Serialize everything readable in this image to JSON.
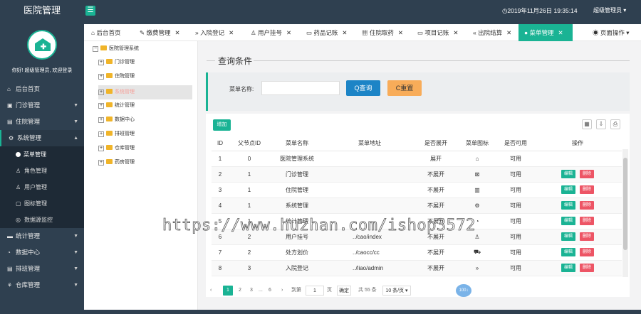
{
  "app": {
    "title": "医院管理",
    "menu_toggle_icon": "☰"
  },
  "header": {
    "datetime": "◷2019年11月26日 19:35:14",
    "user": "超级管理员"
  },
  "sidebar": {
    "welcome": "你好! 超级管理员, 欢迎登录",
    "items": [
      {
        "label": "后台首页",
        "icon": "⌂"
      },
      {
        "label": "门诊管理",
        "icon": "▣"
      },
      {
        "label": "住院管理",
        "icon": "▤"
      },
      {
        "label": "系统管理",
        "icon": "⚙"
      }
    ],
    "sub_items": [
      {
        "label": "菜单管理",
        "icon": "●"
      },
      {
        "label": "角色管理",
        "icon": "♙"
      },
      {
        "label": "用户管理",
        "icon": "♙"
      },
      {
        "label": "图标管理",
        "icon": "▢"
      },
      {
        "label": "数据源监控",
        "icon": "◎"
      }
    ],
    "items_after": [
      {
        "label": "统计管理",
        "icon": "▬"
      },
      {
        "label": "数据中心",
        "icon": "◔"
      },
      {
        "label": "排班管理",
        "icon": "▤"
      },
      {
        "label": "仓库管理",
        "icon": "⚘"
      }
    ]
  },
  "tabs": [
    {
      "label": "后台首页",
      "icon": "⌂"
    },
    {
      "label": "缴费管理",
      "icon": "✎"
    },
    {
      "label": "入院登记",
      "icon": "»"
    },
    {
      "label": "用户挂号",
      "icon": "♙"
    },
    {
      "label": "药品记账",
      "icon": "▭"
    },
    {
      "label": "住院取药",
      "icon": "▦"
    },
    {
      "label": "项目记账",
      "icon": "▭"
    },
    {
      "label": "出院结算",
      "icon": "«"
    },
    {
      "label": "菜单管理",
      "icon": "●"
    }
  ],
  "tab_actions": "◉ 页面操作 ▾",
  "tree": {
    "root": "医院管理系统",
    "nodes": [
      "门诊管理",
      "住院管理",
      "系统管理",
      "统计管理",
      "数据中心",
      "排班管理",
      "仓库管理",
      "药房管理"
    ]
  },
  "query": {
    "title": "查询条件",
    "menu_name_label": "菜单名称:",
    "search_button": "Q查询",
    "reset_button": "C重置"
  },
  "table": {
    "add_button": "增加",
    "headers": [
      "ID",
      "父节点ID",
      "菜单名称",
      "菜单地址",
      "是否展开",
      "菜单图标",
      "是否可用",
      "操作"
    ],
    "edit_label": "编辑",
    "delete_label": "删除",
    "rows": [
      {
        "id": "1",
        "pid": "0",
        "name": "医院管理系统",
        "url": "",
        "open": "展开",
        "icon": "⌂",
        "available": "可用",
        "ops": false
      },
      {
        "id": "2",
        "pid": "1",
        "name": "门诊管理",
        "url": "",
        "open": "不展开",
        "icon": "⊠",
        "available": "可用",
        "ops": true
      },
      {
        "id": "3",
        "pid": "1",
        "name": "住院管理",
        "url": "",
        "open": "不展开",
        "icon": "▥",
        "available": "可用",
        "ops": true
      },
      {
        "id": "4",
        "pid": "1",
        "name": "系统管理",
        "url": "",
        "open": "不展开",
        "icon": "⚙",
        "available": "可用",
        "ops": true
      },
      {
        "id": "5",
        "pid": "1",
        "name": "统计管理",
        "url": "",
        "open": "不展开",
        "icon": "◔",
        "available": "可用",
        "ops": true
      },
      {
        "id": "6",
        "pid": "2",
        "name": "用户挂号",
        "url": "../cao/index",
        "open": "不展开",
        "icon": "♙",
        "available": "可用",
        "ops": true
      },
      {
        "id": "7",
        "pid": "2",
        "name": "处方划价",
        "url": "../caocc/cc",
        "open": "不展开",
        "icon": "⛟",
        "available": "可用",
        "ops": true
      },
      {
        "id": "8",
        "pid": "3",
        "name": "入院登记",
        "url": "../liao/admin",
        "open": "不展开",
        "icon": "»",
        "available": "可用",
        "ops": true
      }
    ]
  },
  "pager": {
    "pages": [
      "1",
      "2",
      "3",
      "...",
      "6"
    ],
    "goto_label": "到第",
    "goto_value": "1",
    "page_unit": "页",
    "confirm": "确定",
    "total": "共 55 条",
    "page_size": "10 条/页 ▾"
  },
  "watermark": "https://www.huzhan.com/ishop3572",
  "float_button": "100↓"
}
